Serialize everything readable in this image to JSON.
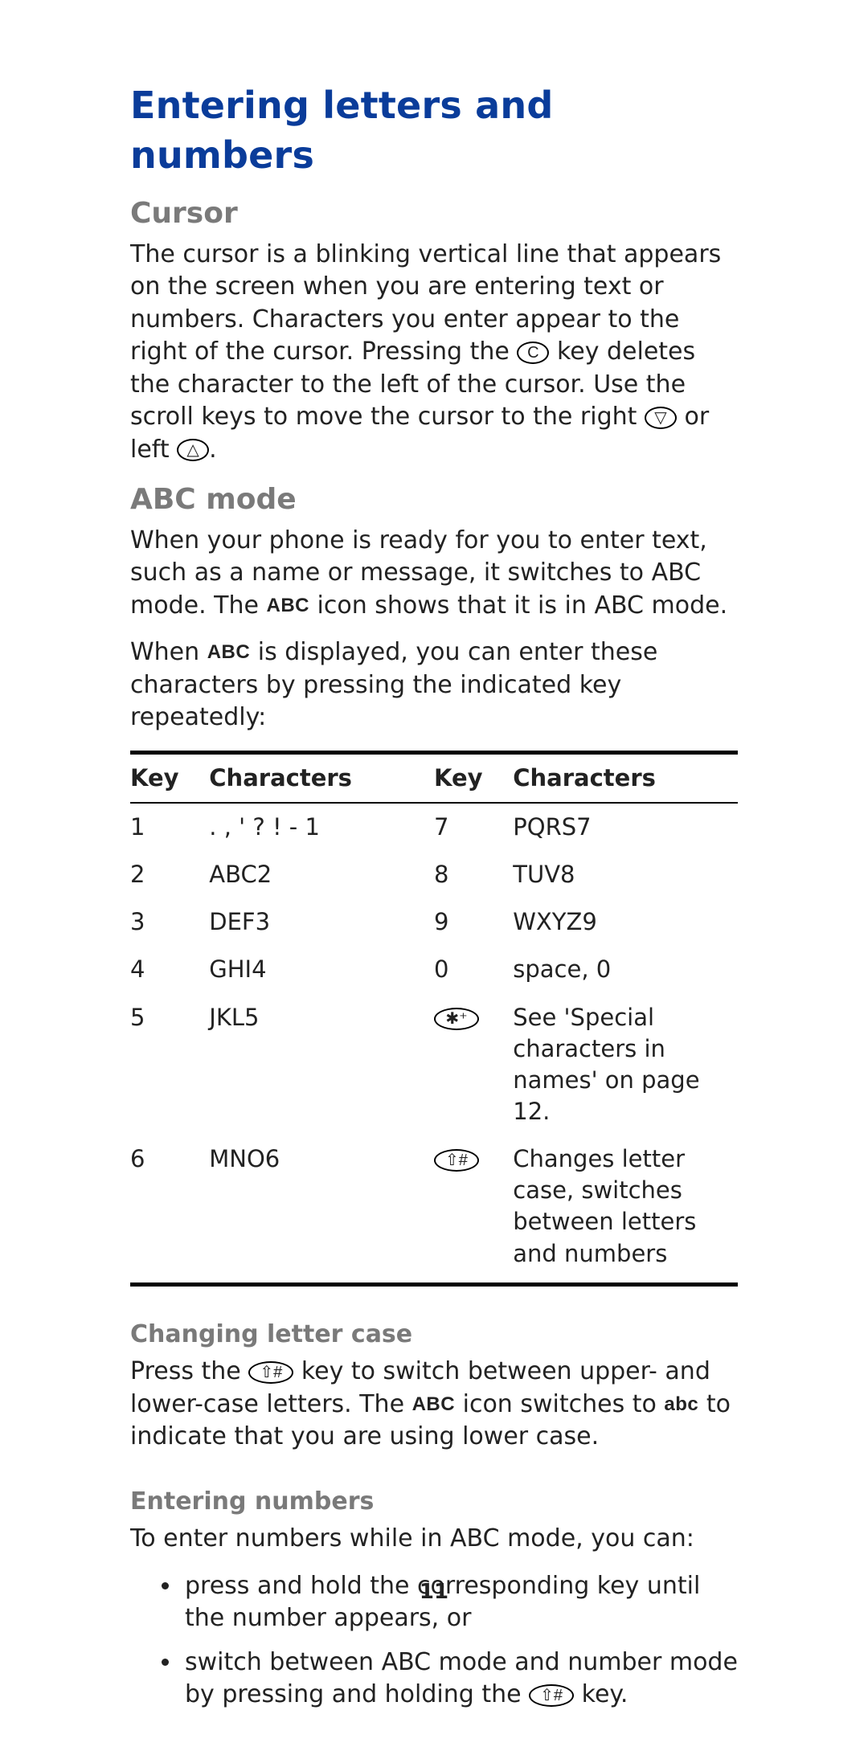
{
  "title": "Entering letters and numbers",
  "sections": {
    "cursor": {
      "heading": "Cursor",
      "paragraph_pre_c": "The cursor is a blinking vertical line that appears on the screen when you are entering text or numbers. Characters you enter appear to the right of the cursor. Pressing the ",
      "c_key": "C",
      "paragraph_mid": " key deletes the character to the left of the cursor. Use the scroll keys to move the cursor to the right ",
      "right_key": "▽",
      "paragraph_mid2": " or left ",
      "left_key": "△",
      "paragraph_end": "."
    },
    "abc": {
      "heading": "ABC mode",
      "p1_pre": "When your phone is ready for you to enter text, such as a name or message, it switches to ABC mode. The ",
      "abc_icon": "ABC",
      "p1_post": " icon shows that it is in ABC mode.",
      "p2_pre": "When ",
      "p2_post": " is displayed, you can enter these characters by pressing the indicated key repeatedly:"
    },
    "table": {
      "headers": {
        "key": "Key",
        "characters": "Characters"
      },
      "rows": [
        {
          "k1": "1",
          "c1": ". , ' ? ! - 1",
          "k2": "7",
          "c2": "PQRS7",
          "k2_is_icon": false
        },
        {
          "k1": "2",
          "c1": "ABC2",
          "k2": "8",
          "c2": "TUV8",
          "k2_is_icon": false
        },
        {
          "k1": "3",
          "c1": "DEF3",
          "k2": "9",
          "c2": "WXYZ9",
          "k2_is_icon": false
        },
        {
          "k1": "4",
          "c1": "GHI4",
          "k2": "0",
          "c2": "space, 0",
          "k2_is_icon": false
        },
        {
          "k1": "5",
          "c1": "JKL5",
          "k2": "✱⁺",
          "c2": "See 'Special characters in names' on page 12.",
          "k2_is_icon": true
        },
        {
          "k1": "6",
          "c1": "MNO6",
          "k2": "⇧#",
          "c2": "Changes letter case, switches between letters and numbers",
          "k2_is_icon": true
        }
      ]
    },
    "case": {
      "heading": "Changing letter case",
      "p_pre": "Press the ",
      "hash_key": "⇧#",
      "p_mid": " key to switch between upper- and lower-case letters. The ",
      "abc_upper": "ABC",
      "p_mid2": " icon switches to ",
      "abc_lower": "abc",
      "p_post": " to indicate that you are using lower case."
    },
    "numbers": {
      "heading": "Entering numbers",
      "intro": "To enter numbers while in ABC mode, you can:",
      "bullets": {
        "b1": "press and hold the corresponding key until the number appears, or",
        "b2_pre": "switch between ABC mode and number mode by pressing and holding the ",
        "b2_key": "⇧#",
        "b2_post": " key."
      }
    }
  },
  "page_number": "11"
}
